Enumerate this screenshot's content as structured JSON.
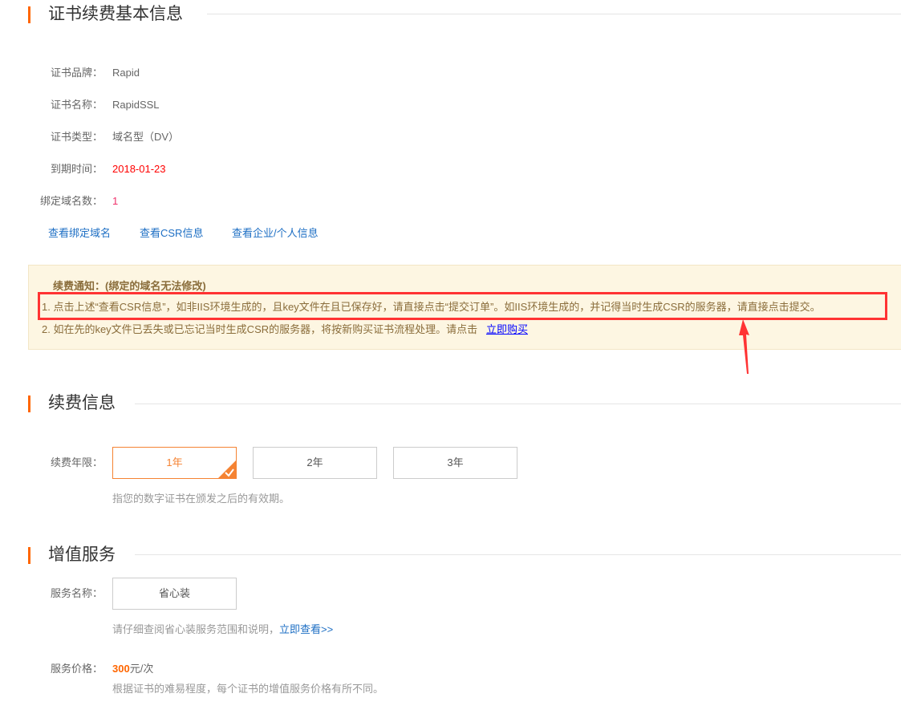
{
  "basic": {
    "title": "证书续费基本信息",
    "fields": [
      {
        "label": "证书品牌：",
        "value": "Rapid"
      },
      {
        "label": "证书名称：",
        "value": "RapidSSL"
      },
      {
        "label": "证书类型：",
        "value": "域名型（DV）"
      },
      {
        "label": "到期时间：",
        "value": "2018-01-23"
      },
      {
        "label": "绑定域名数：",
        "value": "1"
      }
    ],
    "links": [
      "查看绑定域名",
      "查看CSR信息",
      "查看企业/个人信息"
    ]
  },
  "notice": {
    "title": "续费通知：(绑定的域名无法修改)",
    "line1": "1. 点击上述“查看CSR信息”，如非IIS环境生成的，且key文件在且已保存好，请直接点击“提交订单”。如IIS环境生成的，并记得当时生成CSR的服务器，请直接点击提交。",
    "line2": "2. 如在先的key文件已丢失或已忘记当时生成CSR的服务器，将按新购买证书流程处理。请点击",
    "buy_link": "立即购买"
  },
  "renew": {
    "title": "续费信息",
    "label": "续费年限：",
    "options": [
      "1年",
      "2年",
      "3年"
    ],
    "selected": "1年",
    "hint": "指您的数字证书在颁发之后的有效期。"
  },
  "addon": {
    "title": "增值服务",
    "name_label": "服务名称：",
    "service": "省心装",
    "desc": "请仔细查阅省心装服务范围和说明，",
    "desc_link": "立即查看>>",
    "price_label": "服务价格：",
    "price": "300",
    "price_unit": "元/次",
    "price_hint": "根据证书的难易程度，每个证书的增值服务价格有所不同。"
  },
  "colors": {
    "accent": "#ff6600",
    "link": "#1e6fc4",
    "highlight": "#ff3333",
    "date": "#ff0000"
  }
}
